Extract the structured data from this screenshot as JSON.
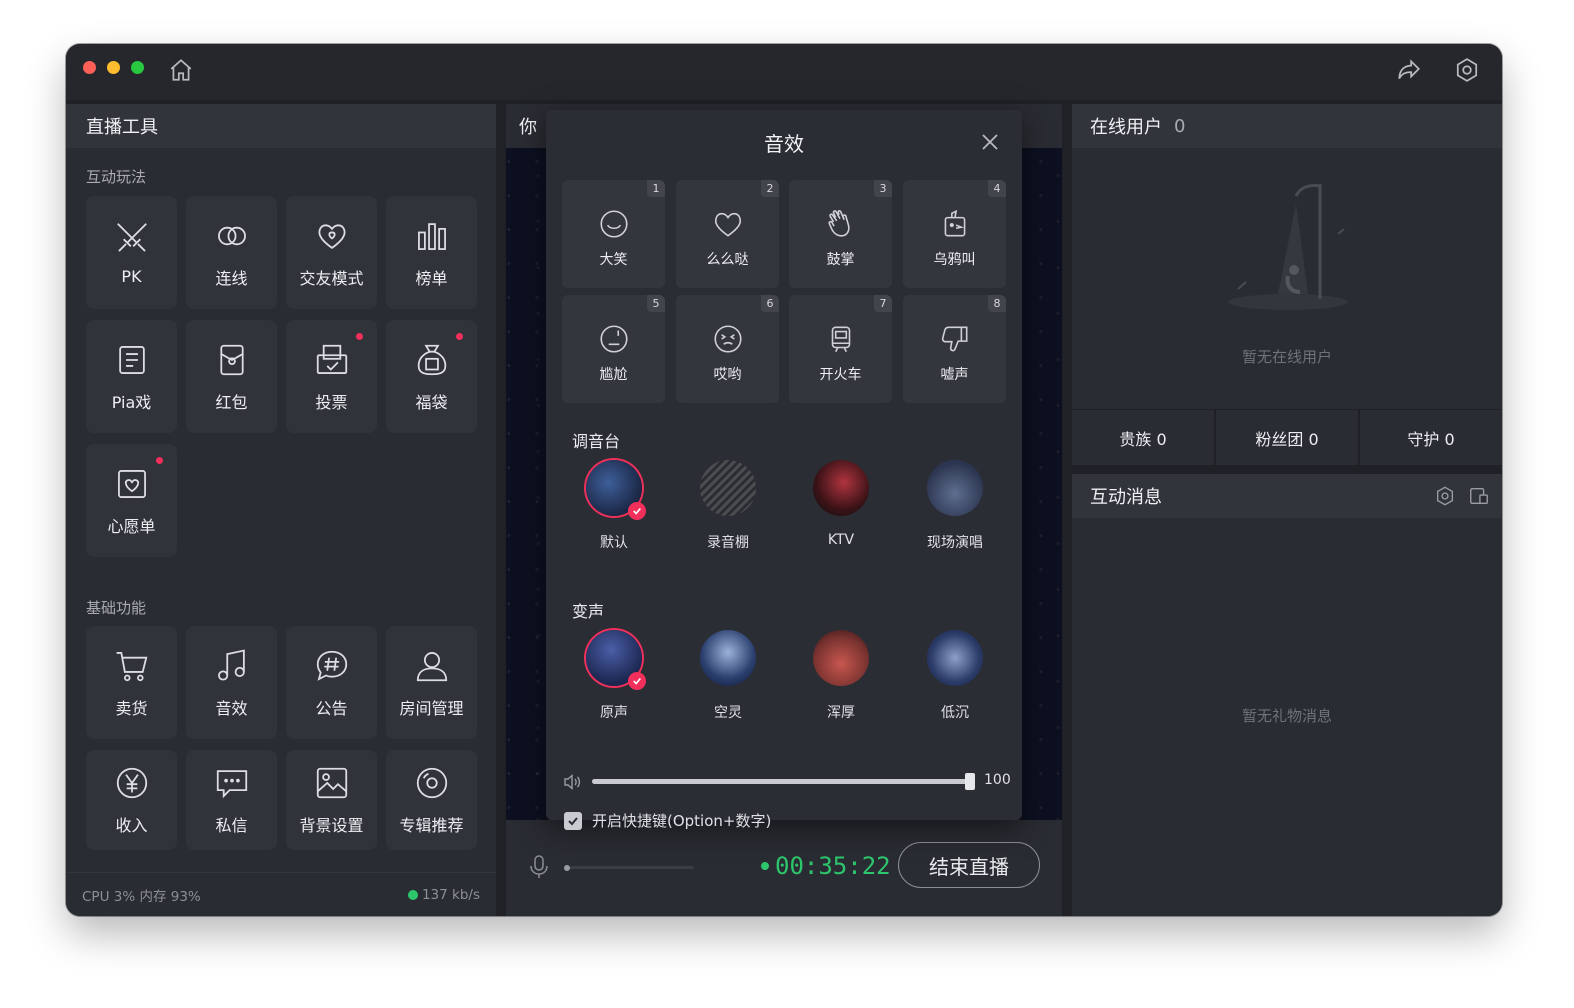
{
  "left": {
    "title": "直播工具",
    "section_interactive": "互动玩法",
    "interactive": [
      {
        "label": "PK",
        "icon": "swords-icon",
        "dot": false
      },
      {
        "label": "连线",
        "icon": "link-rings-icon",
        "dot": false
      },
      {
        "label": "交友模式",
        "icon": "hearts-icon",
        "dot": false
      },
      {
        "label": "榜单",
        "icon": "bar-chart-icon",
        "dot": false
      },
      {
        "label": "Pia戏",
        "icon": "script-icon",
        "dot": false
      },
      {
        "label": "红包",
        "icon": "red-envelope-icon",
        "dot": false
      },
      {
        "label": "投票",
        "icon": "vote-icon",
        "dot": true
      },
      {
        "label": "福袋",
        "icon": "lucky-bag-icon",
        "dot": true
      },
      {
        "label": "心愿单",
        "icon": "wishlist-icon",
        "dot": true
      }
    ],
    "section_basic": "基础功能",
    "basic": [
      {
        "label": "卖货",
        "icon": "cart-icon"
      },
      {
        "label": "音效",
        "icon": "music-note-icon"
      },
      {
        "label": "公告",
        "icon": "announcement-icon"
      },
      {
        "label": "房间管理",
        "icon": "user-icon"
      },
      {
        "label": "收入",
        "icon": "yuan-icon"
      },
      {
        "label": "私信",
        "icon": "message-icon"
      },
      {
        "label": "背景设置",
        "icon": "image-icon"
      },
      {
        "label": "专辑推荐",
        "icon": "disc-icon"
      }
    ],
    "footer_stats": "CPU 3% 内存 93%",
    "footer_speed": "137 kb/s"
  },
  "center": {
    "title_fragment": "你",
    "timer": "00:35:22",
    "end_button": "结束直播"
  },
  "modal": {
    "title": "音效",
    "effects": [
      {
        "num": "1",
        "label": "大笑",
        "icon": "laugh-icon"
      },
      {
        "num": "2",
        "label": "么么哒",
        "icon": "heart-icon"
      },
      {
        "num": "3",
        "label": "鼓掌",
        "icon": "clap-icon"
      },
      {
        "num": "4",
        "label": "乌鸦叫",
        "icon": "crow-icon"
      },
      {
        "num": "5",
        "label": "尴尬",
        "icon": "awkward-face-icon"
      },
      {
        "num": "6",
        "label": "哎哟",
        "icon": "ouch-face-icon"
      },
      {
        "num": "7",
        "label": "开火车",
        "icon": "train-icon"
      },
      {
        "num": "8",
        "label": "嘘声",
        "icon": "thumbs-down-icon"
      }
    ],
    "mixer_title": "调音台",
    "mixer": [
      {
        "label": "默认",
        "selected": true
      },
      {
        "label": "录音棚",
        "selected": false
      },
      {
        "label": "KTV",
        "selected": false
      },
      {
        "label": "现场演唱",
        "selected": false
      }
    ],
    "voice_title": "变声",
    "voice": [
      {
        "label": "原声",
        "selected": true
      },
      {
        "label": "空灵",
        "selected": false
      },
      {
        "label": "浑厚",
        "selected": false
      },
      {
        "label": "低沉",
        "selected": false
      }
    ],
    "volume": 100,
    "volume_label": "100",
    "shortcut_label": "开启快捷键(Option+数字)",
    "shortcut_checked": true
  },
  "right": {
    "online_title": "在线用户",
    "online_count": "0",
    "online_empty": "暂无在线用户",
    "tabs": [
      "贵族 0",
      "粉丝团 0",
      "守护 0"
    ],
    "messages_title": "互动消息",
    "messages_empty": "暂无礼物消息"
  },
  "colors": {
    "accent": "#f0305a",
    "timer_green": "#2ec66d"
  }
}
